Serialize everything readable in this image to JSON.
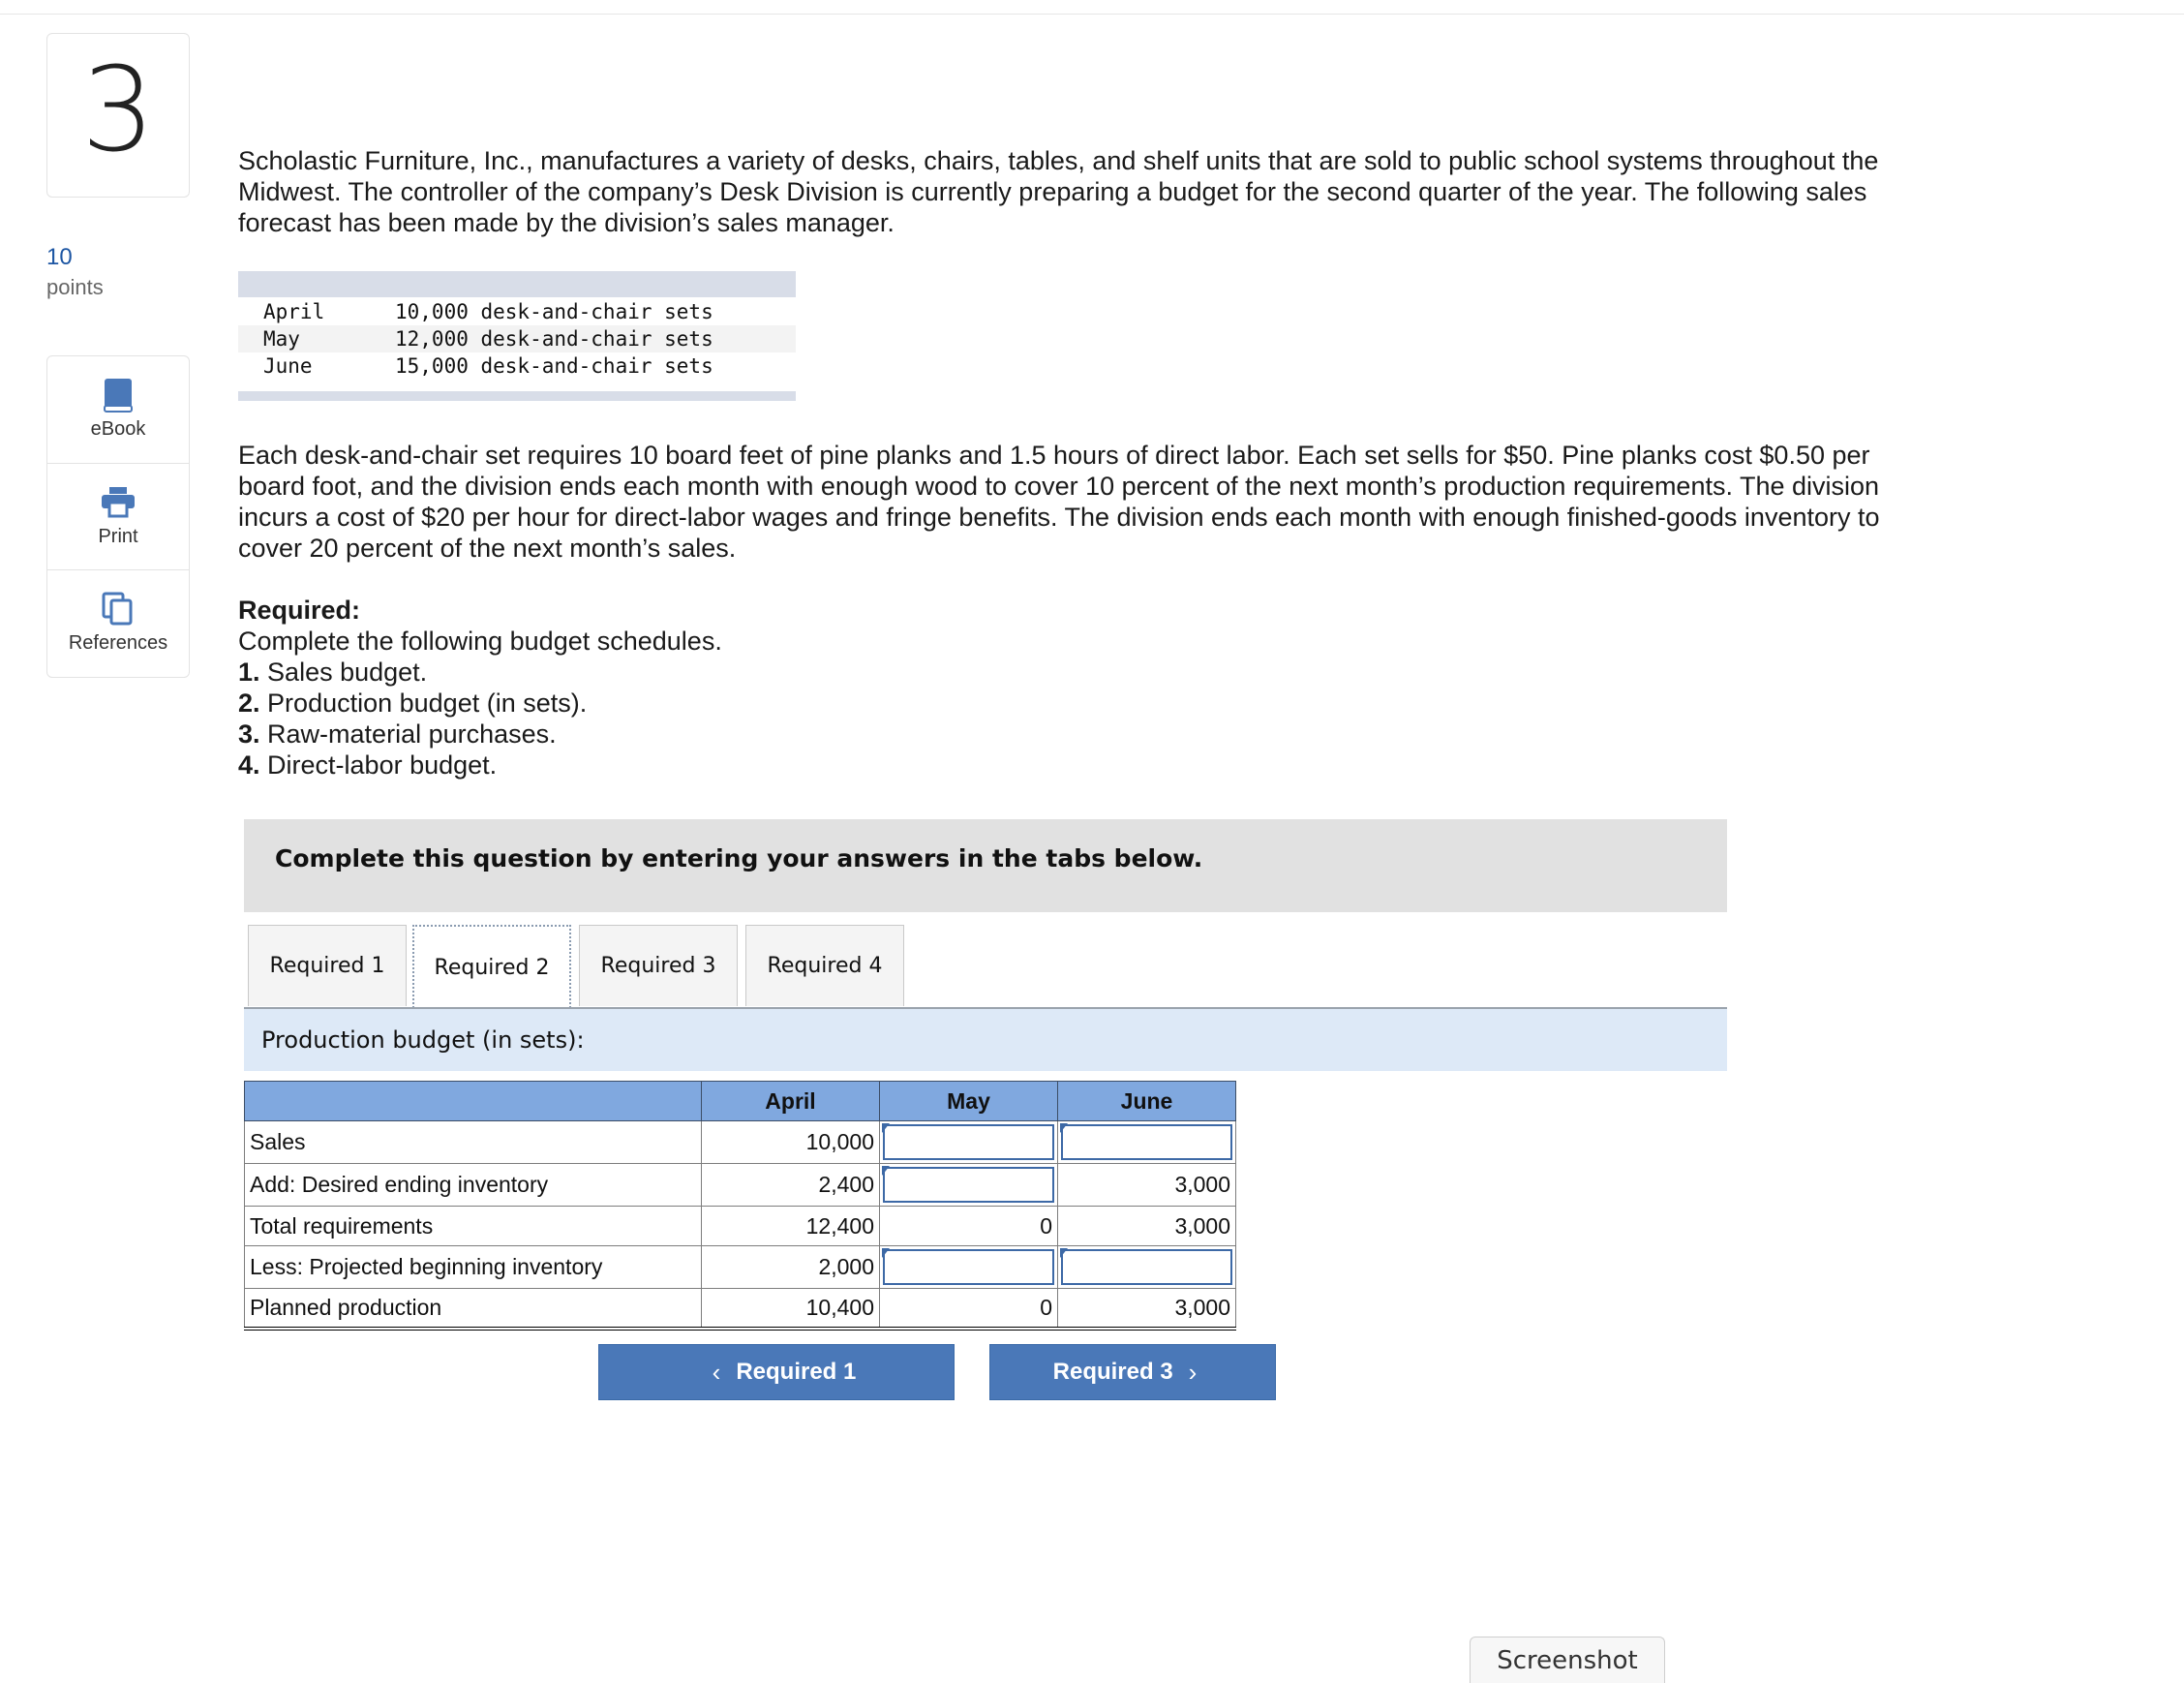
{
  "question": {
    "number": "3",
    "points_value": "10",
    "points_label": "points"
  },
  "tools": [
    {
      "label": "eBook",
      "icon": "book-icon"
    },
    {
      "label": "Print",
      "icon": "printer-icon"
    },
    {
      "label": "References",
      "icon": "references-icon"
    }
  ],
  "intro": "Scholastic Furniture, Inc., manufactures a variety of desks, chairs, tables, and shelf units that are sold to public school systems throughout the Midwest. The controller of the company’s Desk Division is currently preparing a budget for the second quarter of the year. The following sales forecast has been made by the division’s sales manager.",
  "forecast": [
    {
      "month": "April",
      "value": "10,000 desk-and-chair sets"
    },
    {
      "month": "May",
      "value": "12,000 desk-and-chair sets"
    },
    {
      "month": "June",
      "value": "15,000 desk-and-chair sets"
    }
  ],
  "details": "Each desk-and-chair set requires 10 board feet of pine planks and 1.5 hours of direct labor. Each set sells for $50. Pine planks cost $0.50 per board foot, and the division ends each month with enough wood to cover 10 percent of the next month’s production requirements. The division incurs a cost of $20 per hour for direct-labor wages and fringe benefits. The division ends each month with enough finished-goods inventory to cover 20 percent of the next month’s sales.",
  "required": {
    "heading": "Required:",
    "intro": "Complete the following budget schedules.",
    "items": [
      {
        "num": "1.",
        "text": "Sales budget."
      },
      {
        "num": "2.",
        "text": "Production budget (in sets)."
      },
      {
        "num": "3.",
        "text": "Raw-material purchases."
      },
      {
        "num": "4.",
        "text": "Direct-labor budget."
      }
    ]
  },
  "instruction": "Complete this question by entering your answers in the tabs below.",
  "tabs": [
    "Required 1",
    "Required 2",
    "Required 3",
    "Required 4"
  ],
  "active_tab": "Required 2",
  "section_title": "Production budget (in sets):",
  "table": {
    "headers": [
      "",
      "April",
      "May",
      "June"
    ],
    "rows": [
      {
        "label": "Sales",
        "april": "10,000",
        "may": "",
        "june": ""
      },
      {
        "label": "Add: Desired ending inventory",
        "april": "2,400",
        "may": "",
        "june": "3,000"
      },
      {
        "label": "Total requirements",
        "april": "12,400",
        "may": "0",
        "june": "3,000"
      },
      {
        "label": "Less: Projected beginning inventory",
        "april": "2,000",
        "may": "",
        "june": ""
      },
      {
        "label": "Planned production",
        "april": "10,400",
        "may": "0",
        "june": "3,000"
      }
    ]
  },
  "nav": {
    "prev": "Required 1",
    "next": "Required 3"
  },
  "screenshot_button": "Screenshot",
  "colors": {
    "header_blue": "#80a8df",
    "section_blue": "#dde9f7",
    "button_blue": "#4a78b8",
    "link_blue": "#1d56a3"
  }
}
